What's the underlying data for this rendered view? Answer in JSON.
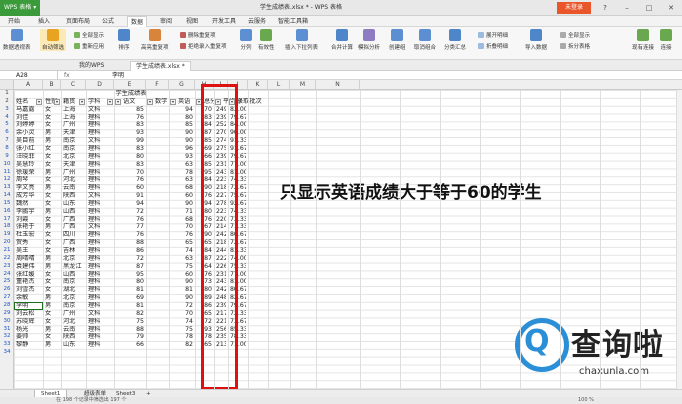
{
  "app": {
    "menu_label": "WPS 表格",
    "window_title": "学生成绩表.xlsx * - WPS 表格",
    "login_label": "未登录"
  },
  "menu_tabs": [
    "开始",
    "插入",
    "页面布局",
    "公式",
    "数据",
    "审阅",
    "视图",
    "开发工具",
    "云服务",
    "智能工具箱"
  ],
  "active_menu": "数据",
  "ribbon": {
    "big": [
      "数据透视表",
      "自动筛选",
      "排序",
      "高亮重复项",
      "分列",
      "有效性",
      "插入下拉列表",
      "合并计算",
      "模拟分析",
      "创建组",
      "取消组合",
      "分类汇总",
      "导入数据",
      "全部显示",
      "现有连接",
      "连接"
    ],
    "small": [
      "全部显示",
      "重新应用",
      "数据对比",
      "删除重复项",
      "拒绝录入重复项",
      "展开明细",
      "折叠明细",
      "拆分表格"
    ]
  },
  "doc_tabs": [
    "我的WPS",
    "学生成绩表.xlsx *"
  ],
  "formula_bar": {
    "cell_ref": "A28",
    "fx": "fx",
    "value": "李明"
  },
  "columns": [
    "A",
    "B",
    "C",
    "D",
    "E",
    "F",
    "G",
    "H",
    "I",
    "J",
    "K",
    "L",
    "M",
    "N"
  ],
  "sheet_title": "学生成绩表",
  "headers": [
    "姓名",
    "性别",
    "籍贯",
    "学科",
    "语文",
    "数学",
    "英语",
    "总分",
    "平均分",
    "录取批次"
  ],
  "rows": [
    {
      "n": "3",
      "c": [
        "马嘉露",
        "女",
        "上海",
        "文科",
        "85",
        "",
        "94",
        "70",
        "249",
        "83.00"
      ]
    },
    {
      "n": "4",
      "c": [
        "刘佳",
        "女",
        "上海",
        "理科",
        "76",
        "",
        "80",
        "83",
        "239",
        "79.67"
      ]
    },
    {
      "n": "5",
      "c": [
        "刘婷婷",
        "女",
        "广州",
        "理科",
        "83",
        "",
        "85",
        "84",
        "252",
        "84.00"
      ]
    },
    {
      "n": "6",
      "c": [
        "余小灵",
        "男",
        "天津",
        "理科",
        "93",
        "",
        "90",
        "87",
        "270",
        "90.00"
      ]
    },
    {
      "n": "7",
      "c": [
        "吴目前",
        "男",
        "南京",
        "文科",
        "99",
        "",
        "90",
        "85",
        "274",
        "91.33"
      ]
    },
    {
      "n": "8",
      "c": [
        "张小红",
        "女",
        "南京",
        "理科",
        "83",
        "",
        "96",
        "69",
        "275",
        "91.67"
      ]
    },
    {
      "n": "9",
      "c": [
        "汪晓菲",
        "女",
        "北京",
        "理科",
        "80",
        "",
        "93",
        "66",
        "239",
        "79.67"
      ]
    },
    {
      "n": "10",
      "c": [
        "吴慧玲",
        "女",
        "天津",
        "理科",
        "83",
        "",
        "63",
        "85",
        "231",
        "77.00"
      ]
    },
    {
      "n": "11",
      "c": [
        "徐瑗荣",
        "男",
        "广州",
        "理科",
        "70",
        "",
        "78",
        "95",
        "243",
        "81.00"
      ]
    },
    {
      "n": "12",
      "c": [
        "周琴",
        "女",
        "河北",
        "理科",
        "76",
        "",
        "63",
        "84",
        "223",
        "74.33"
      ]
    },
    {
      "n": "13",
      "c": [
        "李文亮",
        "男",
        "云南",
        "理科",
        "60",
        "",
        "68",
        "90",
        "218",
        "72.67"
      ]
    },
    {
      "n": "14",
      "c": [
        "成芳华",
        "女",
        "陕西",
        "文科",
        "91",
        "",
        "60",
        "76",
        "227",
        "75.67"
      ]
    },
    {
      "n": "15",
      "c": [
        "魏然",
        "女",
        "山东",
        "理科",
        "94",
        "",
        "90",
        "94",
        "278",
        "92.67"
      ]
    },
    {
      "n": "16",
      "c": [
        "李鹏宇",
        "男",
        "山西",
        "理科",
        "72",
        "",
        "71",
        "80",
        "223",
        "74.33"
      ]
    },
    {
      "n": "17",
      "c": [
        "刘霞",
        "女",
        "广西",
        "理科",
        "76",
        "",
        "68",
        "76",
        "220",
        "73.33"
      ]
    },
    {
      "n": "18",
      "c": [
        "张艳于",
        "男",
        "广西",
        "文科",
        "77",
        "",
        "70",
        "67",
        "214",
        "71.33"
      ]
    },
    {
      "n": "19",
      "c": [
        "杜玉宏",
        "女",
        "四川",
        "理科",
        "76",
        "",
        "76",
        "90",
        "242",
        "80.67"
      ]
    },
    {
      "n": "20",
      "c": [
        "贺秀",
        "女",
        "广西",
        "理科",
        "88",
        "",
        "65",
        "65",
        "218",
        "72.67"
      ]
    },
    {
      "n": "21",
      "c": [
        "吴王",
        "女",
        "吉林",
        "理科",
        "86",
        "",
        "74",
        "84",
        "244",
        "81.33"
      ]
    },
    {
      "n": "22",
      "c": [
        "周晴晴",
        "男",
        "北京",
        "理科",
        "72",
        "",
        "63",
        "87",
        "222",
        "74.00"
      ]
    },
    {
      "n": "23",
      "c": [
        "袁建伟",
        "男",
        "黑龙江",
        "理科",
        "87",
        "",
        "75",
        "64",
        "226",
        "75.33"
      ]
    },
    {
      "n": "24",
      "c": [
        "张红媛",
        "女",
        "山西",
        "理科",
        "95",
        "",
        "60",
        "76",
        "231",
        "77.00"
      ]
    },
    {
      "n": "25",
      "c": [
        "董艳杰",
        "女",
        "南京",
        "理科",
        "80",
        "",
        "90",
        "73",
        "243",
        "81.00"
      ]
    },
    {
      "n": "26",
      "c": [
        "刘雪杰",
        "女",
        "湖北",
        "理科",
        "81",
        "",
        "81",
        "80",
        "242",
        "80.67"
      ]
    },
    {
      "n": "27",
      "c": [
        "余敏",
        "男",
        "北京",
        "理科",
        "69",
        "",
        "90",
        "89",
        "248",
        "82.67"
      ]
    },
    {
      "n": "28",
      "c": [
        "李明",
        "男",
        "南京",
        "理科",
        "81",
        "",
        "72",
        "86",
        "239",
        "79.67"
      ]
    },
    {
      "n": "29",
      "c": [
        "刘云松",
        "女",
        "广州",
        "文科",
        "82",
        "",
        "70",
        "65",
        "217",
        "72.33"
      ]
    },
    {
      "n": "30",
      "c": [
        "苏晓辉",
        "女",
        "河北",
        "理科",
        "75",
        "",
        "74",
        "72",
        "221",
        "73.67"
      ]
    },
    {
      "n": "31",
      "c": [
        "杨光",
        "男",
        "云南",
        "理科",
        "88",
        "",
        "75",
        "93",
        "256",
        "85.33"
      ]
    },
    {
      "n": "32",
      "c": [
        "姜帅",
        "女",
        "陕西",
        "理科",
        "79",
        "",
        "78",
        "78",
        "235",
        "78.33"
      ]
    },
    {
      "n": "33",
      "c": [
        "黎静",
        "男",
        "山东",
        "理科",
        "66",
        "",
        "82",
        "65",
        "213",
        "71.00"
      ]
    },
    {
      "n": "34",
      "c": [
        "",
        "",
        "",
        "",
        "",
        "",
        "",
        "",
        "",
        ""
      ]
    }
  ],
  "annotation": "只显示英语成绩大于等于60的学生",
  "sheet_tabs": [
    "Sheet1",
    "超级表单",
    "Sheet3"
  ],
  "status": {
    "left": "在 198 个记录中筛选出 197 个",
    "zoom": "100 %"
  },
  "watermark": {
    "name": "查询啦",
    "url": "chaxunla.com"
  },
  "colors": {
    "accent_green": "#3b9b3b",
    "highlight_red": "#dd1111",
    "watermark_blue": "#2a8fd6"
  }
}
